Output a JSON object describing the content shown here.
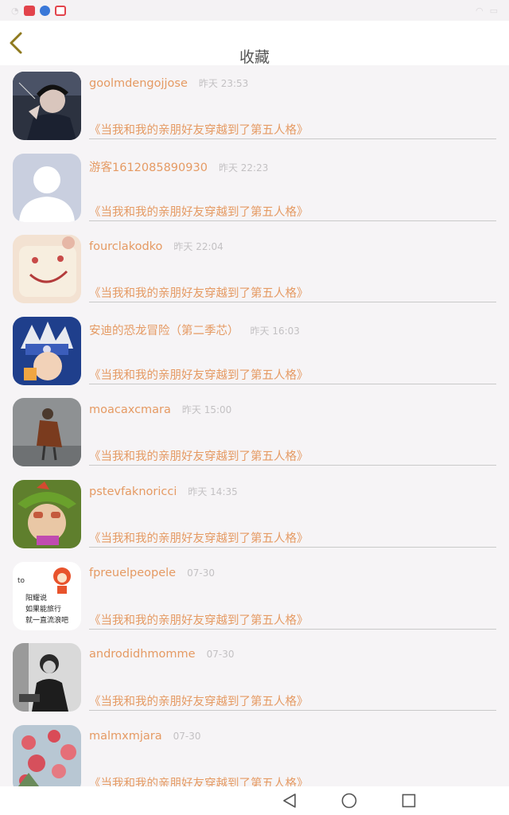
{
  "app": {
    "title": "收藏"
  },
  "favorites": [
    {
      "user": "goolmdengojjose",
      "time": "昨天 23:53",
      "title": "《当我和我的亲朋好友穿越到了第五人格》"
    },
    {
      "user": "游客1612085890930",
      "time": "昨天 22:23",
      "title": "《当我和我的亲朋好友穿越到了第五人格》"
    },
    {
      "user": "fourclakodko",
      "time": "昨天 22:04",
      "title": "《当我和我的亲朋好友穿越到了第五人格》"
    },
    {
      "user": "安迪的恐龙冒险（第二季芯）",
      "time": "昨天 16:03",
      "title": "《当我和我的亲朋好友穿越到了第五人格》"
    },
    {
      "user": "moacaxcmara",
      "time": "昨天 15:00",
      "title": "《当我和我的亲朋好友穿越到了第五人格》"
    },
    {
      "user": "pstevfaknoricci",
      "time": "昨天 14:35",
      "title": "《当我和我的亲朋好友穿越到了第五人格》"
    },
    {
      "user": "fpreuelpeopele",
      "time": "07-30",
      "title": "《当我和我的亲朋好友穿越到了第五人格》"
    },
    {
      "user": "androdidhmomme",
      "time": "07-30",
      "title": "《当我和我的亲朋好友穿越到了第五人格》"
    },
    {
      "user": "malmxmjara",
      "time": "07-30",
      "title": "《当我和我的亲朋好友穿越到了第五人格》"
    }
  ],
  "avatar_sticker_text": [
    "to",
    "阳耀说",
    "如果能旅行",
    "就一直流浪吧"
  ],
  "colors": {
    "accent": "#e59a63",
    "back_icon": "#8f7a1e"
  },
  "icons": {
    "back": "chevron-left-icon",
    "nav_back": "triangle-back-icon",
    "nav_home": "circle-home-icon",
    "nav_recent": "square-recent-icon"
  }
}
